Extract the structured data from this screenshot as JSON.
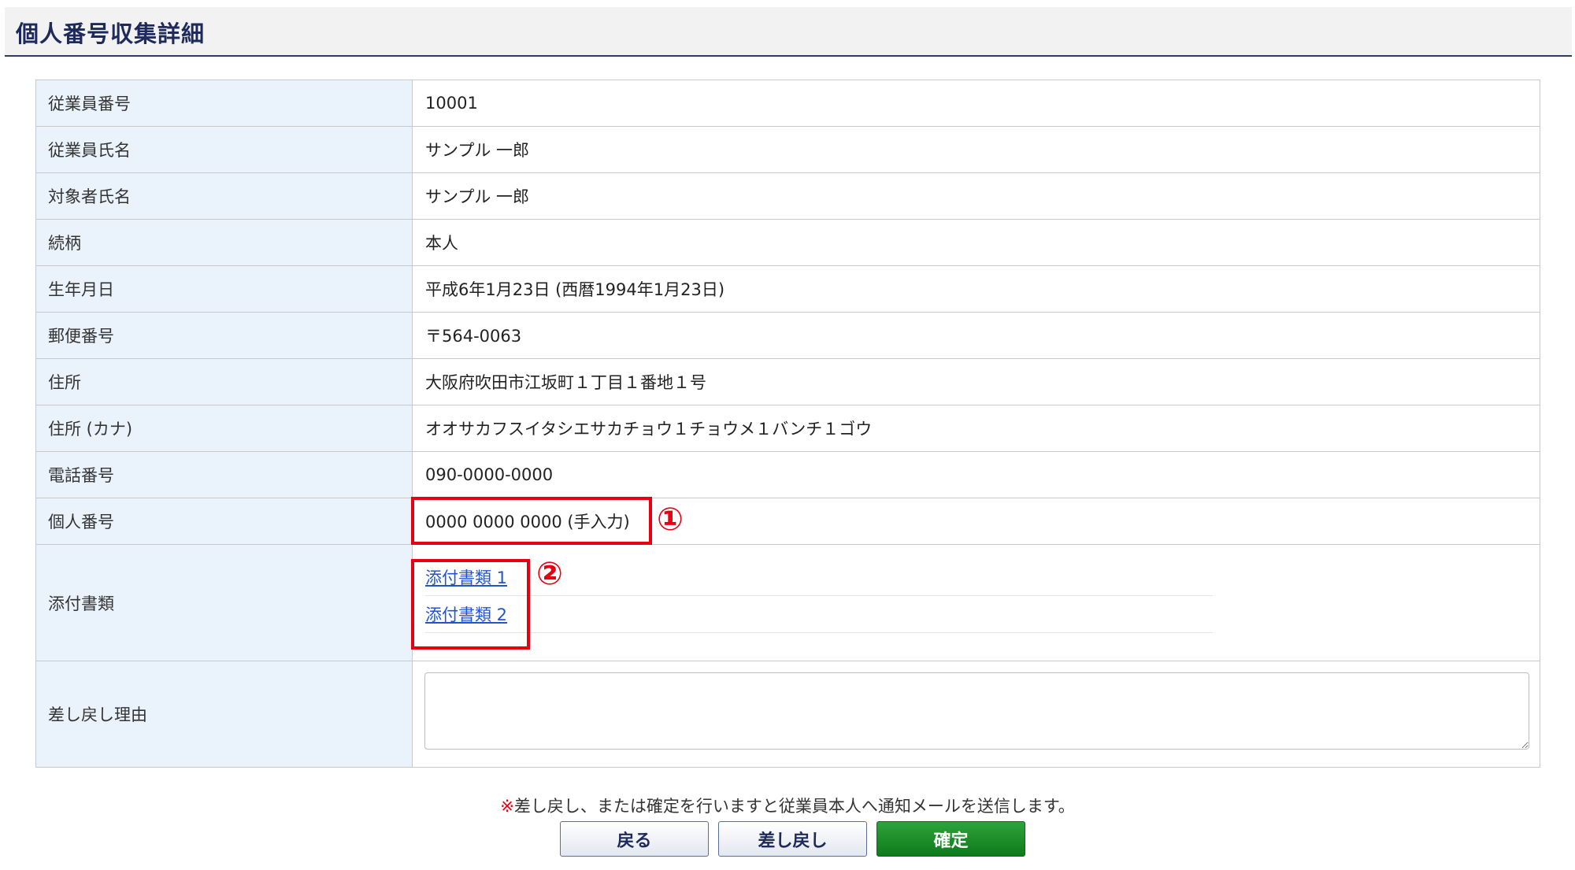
{
  "page": {
    "title": "個人番号収集詳細"
  },
  "rows": [
    {
      "label": "従業員番号",
      "value": "10001"
    },
    {
      "label": "従業員氏名",
      "value": "サンプル 一郎"
    },
    {
      "label": "対象者氏名",
      "value": "サンプル 一郎"
    },
    {
      "label": "続柄",
      "value": "本人"
    },
    {
      "label": "生年月日",
      "value": "平成6年1月23日 (西暦1994年1月23日)"
    },
    {
      "label": "郵便番号",
      "value": "〒564-0063"
    },
    {
      "label": "住所",
      "value": "大阪府吹田市江坂町１丁目１番地１号"
    },
    {
      "label": "住所 (カナ)",
      "value": "オオサカフスイタシエサカチョウ１チョウメ１バンチ１ゴウ"
    },
    {
      "label": "電話番号",
      "value": "090-0000-0000"
    },
    {
      "label": "個人番号",
      "value": "0000 0000 0000 (手入力)"
    }
  ],
  "attachments": {
    "label": "添付書類",
    "items": [
      "添付書類 1",
      "添付書類 2"
    ]
  },
  "reason": {
    "label": "差し戻し理由",
    "value": ""
  },
  "markers": {
    "one": "①",
    "two": "②",
    "color": "#e60012"
  },
  "notice": {
    "mark": "※",
    "text": "差し戻し、または確定を行いますと従業員本人へ通知メールを送信します。"
  },
  "buttons": {
    "back": "戻る",
    "return": "差し戻し",
    "confirm": "確定"
  }
}
